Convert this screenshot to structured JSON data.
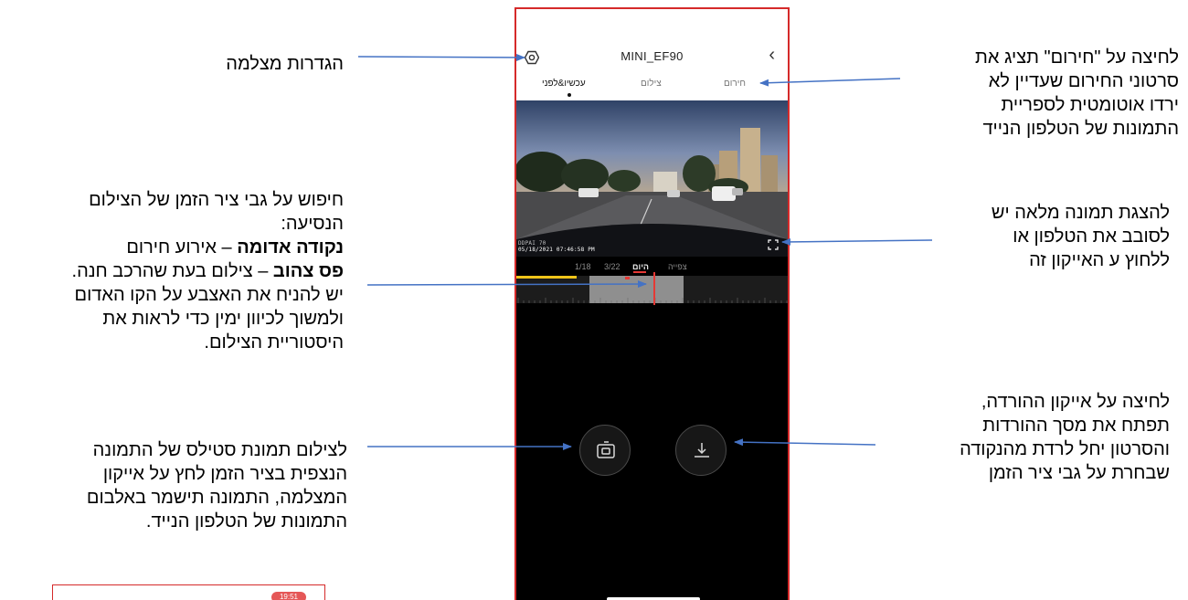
{
  "phone": {
    "title": "MINI_EF90",
    "back_glyph": "‹",
    "tabs": [
      "עכשיו&לפני",
      "צילום",
      "חירום"
    ],
    "timestamp": "05/18/2021 07:46:58 PM",
    "watermark": "DDPAI 70",
    "timeline_labels": [
      "1/18",
      "3/22",
      "היום",
      "צפייה"
    ],
    "icons": {
      "settings": "gear-icon",
      "back": "chevron-left-icon",
      "fullscreen": "fullscreen-icon",
      "snapshot": "camera-icon",
      "download": "download-icon"
    }
  },
  "annotations": {
    "camera_settings": "הגדרות מצלמה",
    "emergency": [
      "לחיצה על \"חירום\" תציג את",
      "סרטוני החירום שעדיין לא",
      "ירדו אוטומטית לספריית",
      "התמונות של הטלפון הנייד"
    ],
    "timeline_intro": [
      "חיפוש על גבי ציר הזמן של הצילום",
      "הנסיעה:"
    ],
    "red_dot_label": "נקודה אדומה",
    "red_dot_text": " – אירוע חירום",
    "yellow_bar_label": "פס צהוב",
    "yellow_bar_text": " – צילום בעת שהרכב חנה.",
    "timeline_outro": [
      "יש להניח את האצבע על הקו האדום",
      "ולמשוך לכיוון ימין כדי לראות את",
      "היסטוריית הצילום."
    ],
    "fullscreen": [
      "להצגת תמונה מלאה יש",
      "לסובב את הטלפון או",
      "ללחוץ ע האייקון זה"
    ],
    "download": [
      "לחיצה על אייקון ההורדה,",
      "תפתח את מסך ההורדות",
      "והסרטון יחל לרדת מהנקודה",
      "שבחרת על גבי ציר הזמן"
    ],
    "snapshot": [
      "לצילום תמונת סטילס של התמונה",
      "הנצפית בציר הזמן לחץ על אייקון",
      "המצלמה, התמונה תישמר באלבום",
      "התמונות של הטלפון הנייד."
    ]
  },
  "bottom_preview": {
    "badge": "19:51"
  },
  "colors": {
    "frame_red": "#d52a2a",
    "arrow_blue": "#4472c4",
    "timeline_red": "#e53935",
    "parked_yellow": "#f0c419",
    "app_bg": "#000000"
  }
}
